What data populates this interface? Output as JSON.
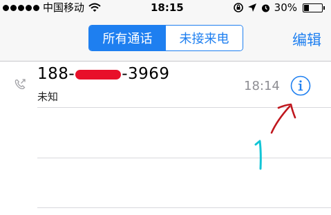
{
  "status_bar": {
    "carrier": "中国移动",
    "time": "18:15",
    "battery_text": "30%",
    "battery_level": 0.3,
    "signal_dots": 5,
    "icons": [
      "wifi-icon",
      "rotation-lock-icon",
      "location-arrow-icon",
      "alarm-icon",
      "battery-icon"
    ]
  },
  "nav": {
    "tabs": [
      {
        "label": "所有通话",
        "selected": true
      },
      {
        "label": "未接来电",
        "selected": false
      }
    ],
    "edit_label": "编辑"
  },
  "calls": [
    {
      "number_prefix": "188-",
      "number_suffix": "-3969",
      "label": "未知",
      "time": "18:14",
      "icons": [
        "outgoing-call-icon",
        "info-icon"
      ]
    }
  ],
  "annotation": {
    "text": "1",
    "arrow_color": "#c0171e",
    "text_color": "#13c5d6"
  },
  "colors": {
    "accent": "#1e7ff0",
    "secondary_text": "#8e8e93",
    "redaction": "#e8102a"
  }
}
